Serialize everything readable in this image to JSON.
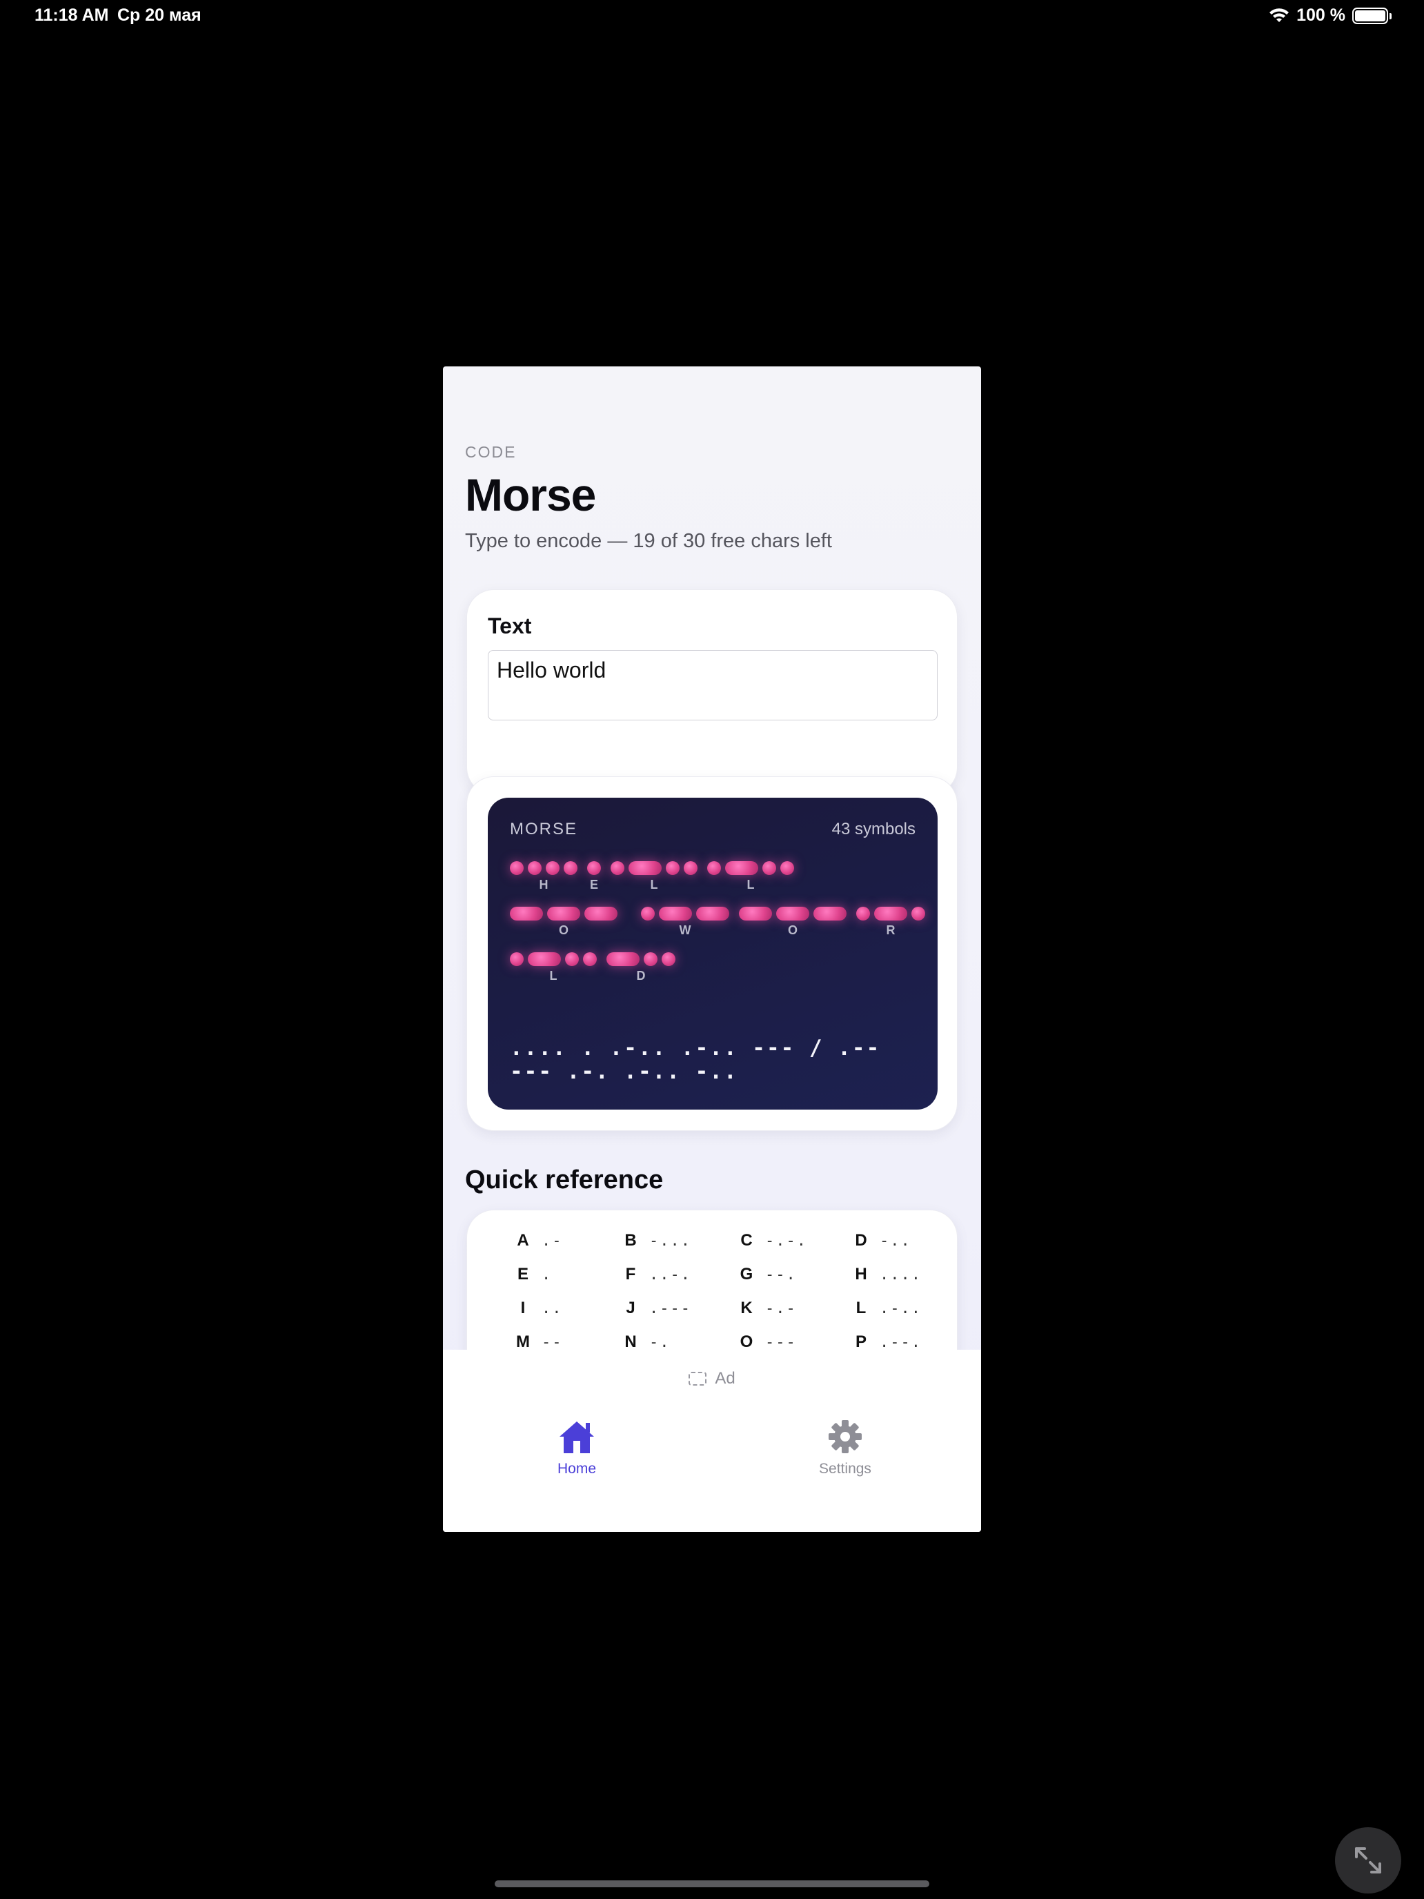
{
  "status_bar": {
    "time": "11:18 AM",
    "date": "Ср 20 мая",
    "battery": "100 %"
  },
  "header": {
    "eyebrow": "CODE",
    "title": "Morse",
    "subtitle": "Type to encode — 19 of 30 free chars left"
  },
  "text_card": {
    "label": "Text",
    "value": "Hello world"
  },
  "morse_card": {
    "label": "MORSE",
    "count": "43 symbols",
    "string": ".... . .-.. .-.. --- / .-- --- .-. .-.. -..",
    "display_lines": [
      ".... . .-.. .-.. --- / .--",
      "--- .-. .-.. -.."
    ],
    "accent_color": "#e8519a",
    "visual_rows": [
      {
        "letters": [
          "H",
          "E",
          "L",
          "L"
        ]
      },
      {
        "letters": [
          "O",
          "W",
          "O"
        ]
      },
      {
        "letters": [
          "R",
          "L",
          "D"
        ]
      }
    ]
  },
  "reference": {
    "title": "Quick reference",
    "items": [
      {
        "letter": "A",
        "code": ".-"
      },
      {
        "letter": "B",
        "code": "-..."
      },
      {
        "letter": "C",
        "code": "-.-."
      },
      {
        "letter": "D",
        "code": "-.."
      },
      {
        "letter": "E",
        "code": "."
      },
      {
        "letter": "F",
        "code": "..-."
      },
      {
        "letter": "G",
        "code": "--."
      },
      {
        "letter": "H",
        "code": "...."
      },
      {
        "letter": "I",
        "code": ".."
      },
      {
        "letter": "J",
        "code": ".---"
      },
      {
        "letter": "K",
        "code": "-.-"
      },
      {
        "letter": "L",
        "code": ".-.."
      },
      {
        "letter": "M",
        "code": "--"
      },
      {
        "letter": "N",
        "code": "-."
      },
      {
        "letter": "O",
        "code": "---"
      },
      {
        "letter": "P",
        "code": ".--."
      }
    ]
  },
  "ad": {
    "label": "Ad",
    "icon": "ad-placeholder-icon"
  },
  "tabs": [
    {
      "label": "Home",
      "icon": "house-icon",
      "active": true,
      "color": "#4b3fd8"
    },
    {
      "label": "Settings",
      "icon": "gear-icon",
      "active": false,
      "color": "#8e8e96"
    }
  ],
  "colors": {
    "accent": "#4b3fd8",
    "panel_bg": "#1b1c44",
    "symbol": "#e8519a"
  }
}
